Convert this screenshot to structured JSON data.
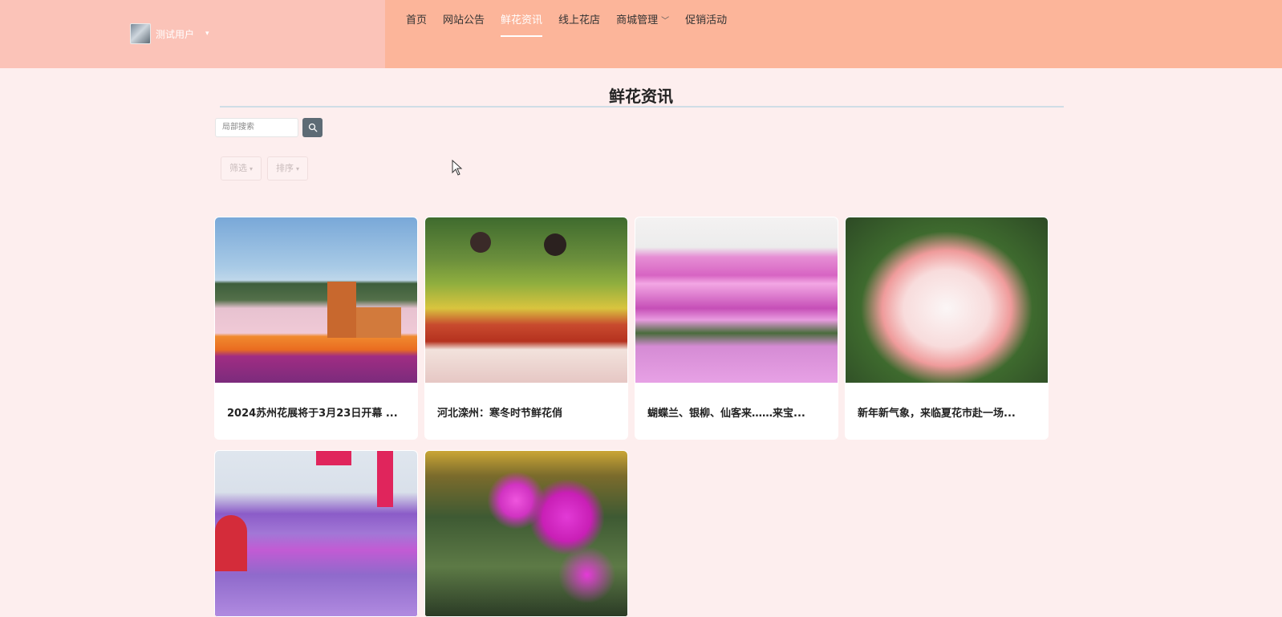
{
  "header": {
    "user": {
      "name": "测试用户",
      "avatar_icon": "user-avatar"
    },
    "nav": [
      {
        "label": "首页",
        "active": false
      },
      {
        "label": "网站公告",
        "active": false
      },
      {
        "label": "鲜花资讯",
        "active": true
      },
      {
        "label": "线上花店",
        "active": false
      },
      {
        "label": "商城管理",
        "active": false,
        "has_dropdown": true
      },
      {
        "label": "促销活动",
        "active": false
      }
    ],
    "colors": {
      "left_bg": "#fbc3b8",
      "right_bg": "#fcb59a"
    }
  },
  "page": {
    "title": "鲜花资讯",
    "search": {
      "placeholder": "局部搜索",
      "button_icon": "search-icon"
    },
    "filters": [
      {
        "label": "筛选"
      },
      {
        "label": "排序"
      }
    ]
  },
  "cards": [
    {
      "title": "2024苏州花展将于3月23日开幕 ...",
      "image": "tulip field with windmill"
    },
    {
      "title": "河北滦州：寒冬时节鲜花俏",
      "image": "florists among potted orchids"
    },
    {
      "title": "蝴蝶兰、银柳、仙客来……来宝...",
      "image": "rows of pink phalaenopsis"
    },
    {
      "title": "新年新气象，来临夏花市赴一场...",
      "image": "white and pink amaryllis"
    },
    {
      "title": "",
      "image": "orchid greenhouse market"
    },
    {
      "title": "",
      "image": "magenta orchids"
    }
  ]
}
